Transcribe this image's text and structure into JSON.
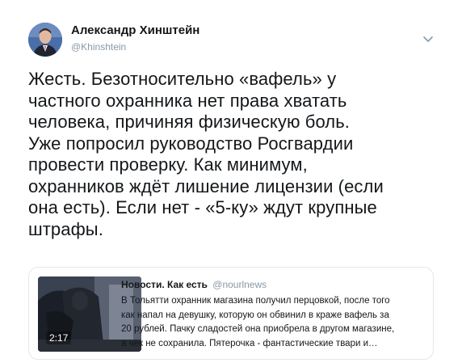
{
  "author": {
    "name": "Александр Хинштейн",
    "handle": "@Khinshtein",
    "avatar_icon": "author-avatar"
  },
  "tweet": {
    "lines": [
      "Жесть. Безотносительно «вафель» у",
      "частного охранника нет права хватать",
      "человека, причиняя физическую боль.",
      "Уже попросил руководство Росгвардии",
      "провести проверку. Как минимум,",
      "охранников ждёт лишение лицензии (если",
      "она есть). Если нет - «5-ку» ждут крупные",
      "штрафы."
    ]
  },
  "quoted": {
    "name": "Новости. Как есть",
    "handle": "@nourlnews",
    "video_duration": "2:17",
    "lines": [
      "В Тольятти охранник магазина получил перцовкой, после того",
      "как напал на девушку, которую он обвинил в краже вафель за",
      "20 рублей. Пачку сладостей она приобрела в другом магазине,",
      "а чек не сохранила. Пятерочка - фантастические твари и…"
    ]
  },
  "colors": {
    "text": "#14171a",
    "secondary": "#8899a6",
    "border": "#e1e8ed"
  },
  "icons": {
    "menu": "chevron-down-icon"
  }
}
